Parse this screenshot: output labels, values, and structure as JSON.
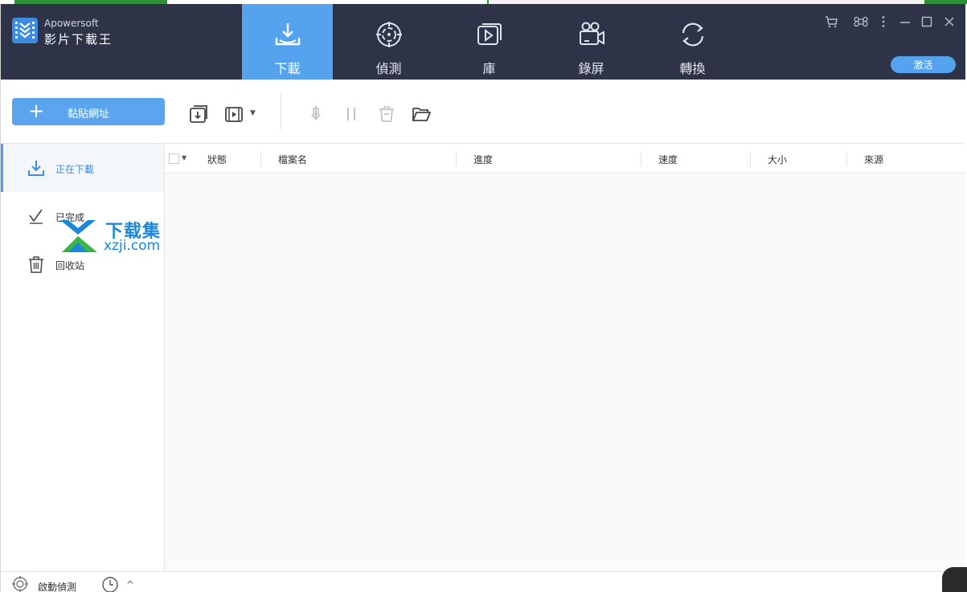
{
  "app": {
    "brand_line1": "Apowersoft",
    "brand_line2": "影片下載王",
    "accent": "#55a3ee",
    "header_bg": "#2e3347"
  },
  "nav": {
    "tabs": [
      {
        "label": "下載",
        "icon": "download-tray-icon",
        "active": true
      },
      {
        "label": "偵測",
        "icon": "crosshair-target-icon",
        "active": false
      },
      {
        "label": "庫",
        "icon": "video-library-icon",
        "active": false
      },
      {
        "label": "錄屏",
        "icon": "video-camera-icon",
        "active": false
      },
      {
        "label": "轉換",
        "icon": "convert-cycle-icon",
        "active": false
      }
    ]
  },
  "window_controls": {
    "activate_label": "激活",
    "icons": [
      "cart-icon",
      "command-icon",
      "more-vertical-icon",
      "minimize-icon",
      "maximize-icon",
      "close-icon"
    ]
  },
  "toolbar": {
    "paste_label": "黏貼網址",
    "icons": [
      "download-file-icon",
      "video-file-icon",
      "resume-icon",
      "pause-icon",
      "delete-icon",
      "open-folder-icon"
    ]
  },
  "sidebar": {
    "items": [
      {
        "label": "正在下載",
        "icon": "download-icon",
        "active": true
      },
      {
        "label": "已完成",
        "icon": "check-icon",
        "active": false
      },
      {
        "label": "回收站",
        "icon": "trash-icon",
        "active": false
      }
    ]
  },
  "table": {
    "columns": [
      "狀態",
      "檔案名",
      "進度",
      "速度",
      "大小",
      "來源"
    ],
    "rows": []
  },
  "watermark": {
    "cn": "下载集",
    "en": "xzji.com"
  },
  "footer": {
    "detect_label": "啟動偵測"
  }
}
